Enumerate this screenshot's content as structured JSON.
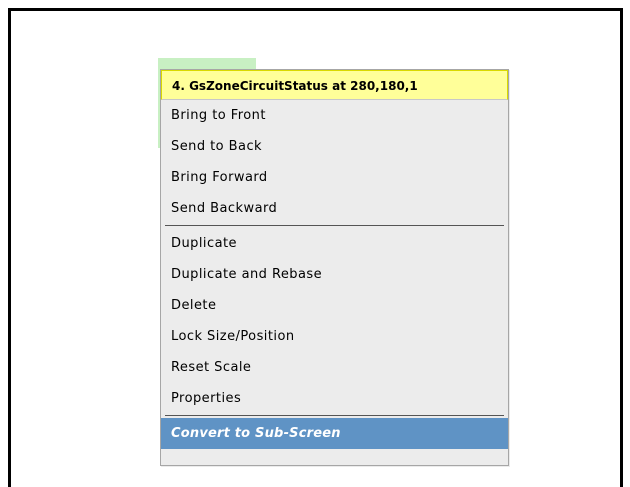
{
  "menu": {
    "title": "4. GsZoneCircuitStatus at 280,180,1",
    "groups": [
      {
        "items": [
          {
            "label": "Bring to Front"
          },
          {
            "label": "Send to Back"
          },
          {
            "label": "Bring Forward"
          },
          {
            "label": "Send Backward"
          }
        ]
      },
      {
        "items": [
          {
            "label": "Duplicate"
          },
          {
            "label": "Duplicate and Rebase"
          },
          {
            "label": "Delete"
          },
          {
            "label": "Lock Size/Position"
          },
          {
            "label": "Reset Scale"
          },
          {
            "label": "Properties"
          }
        ]
      },
      {
        "items": [
          {
            "label": "Convert to Sub-Screen",
            "highlighted": true
          }
        ]
      }
    ]
  },
  "colors": {
    "header_background": "#ffff99",
    "menu_background": "#ececec",
    "highlight_background": "#5f93c5",
    "canvas_widget": "#c8f0c3"
  }
}
